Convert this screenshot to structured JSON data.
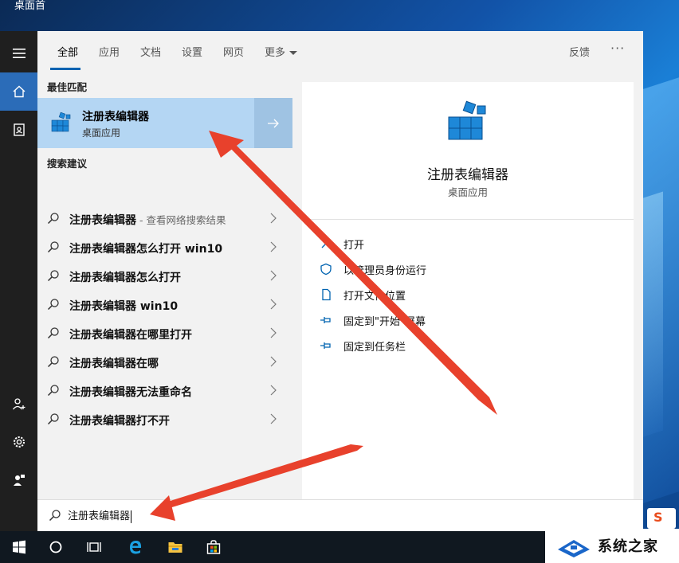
{
  "desktop": {
    "label": "桌面首"
  },
  "tabs": [
    {
      "label": "全部",
      "active": true
    },
    {
      "label": "应用"
    },
    {
      "label": "文档"
    },
    {
      "label": "设置"
    },
    {
      "label": "网页"
    },
    {
      "label": "更多"
    }
  ],
  "header": {
    "feedback": "反馈",
    "more": "···"
  },
  "best_match": {
    "section_title": "最佳匹配",
    "name": "注册表编辑器",
    "subtitle": "桌面应用"
  },
  "suggestions": {
    "section_title": "搜索建议",
    "items": [
      {
        "text": "注册表编辑器",
        "hint": " - 查看网络搜索结果"
      },
      {
        "text": "注册表编辑器怎么打开 win10",
        "hint": ""
      },
      {
        "text": "注册表编辑器怎么打开",
        "hint": ""
      },
      {
        "text": "注册表编辑器 win10",
        "hint": ""
      },
      {
        "text": "注册表编辑器在哪里打开",
        "hint": ""
      },
      {
        "text": "注册表编辑器在哪",
        "hint": ""
      },
      {
        "text": "注册表编辑器无法重命名",
        "hint": ""
      },
      {
        "text": "注册表编辑器打不开",
        "hint": ""
      }
    ]
  },
  "detail": {
    "name": "注册表编辑器",
    "subtitle": "桌面应用",
    "actions": [
      {
        "label": "打开",
        "icon": "open-icon"
      },
      {
        "label": "以管理员身份运行",
        "icon": "shield-icon"
      },
      {
        "label": "打开文件位置",
        "icon": "file-location-icon"
      },
      {
        "label": "固定到\"开始\"屏幕",
        "icon": "pin-icon"
      },
      {
        "label": "固定到任务栏",
        "icon": "pin-icon"
      }
    ]
  },
  "search": {
    "value": "注册表编辑器"
  },
  "taskbar": {
    "icons": [
      "windows-start-icon",
      "cortana-icon",
      "task-view-icon",
      "edge-icon",
      "file-explorer-icon",
      "store-icon"
    ]
  },
  "watermark": {
    "text": "系统之家",
    "badge": "S"
  },
  "colors": {
    "accent": "#0063b1",
    "selection": "#b4d6f3",
    "rail": "#1f1f1f",
    "annotation": "#e8412c"
  }
}
